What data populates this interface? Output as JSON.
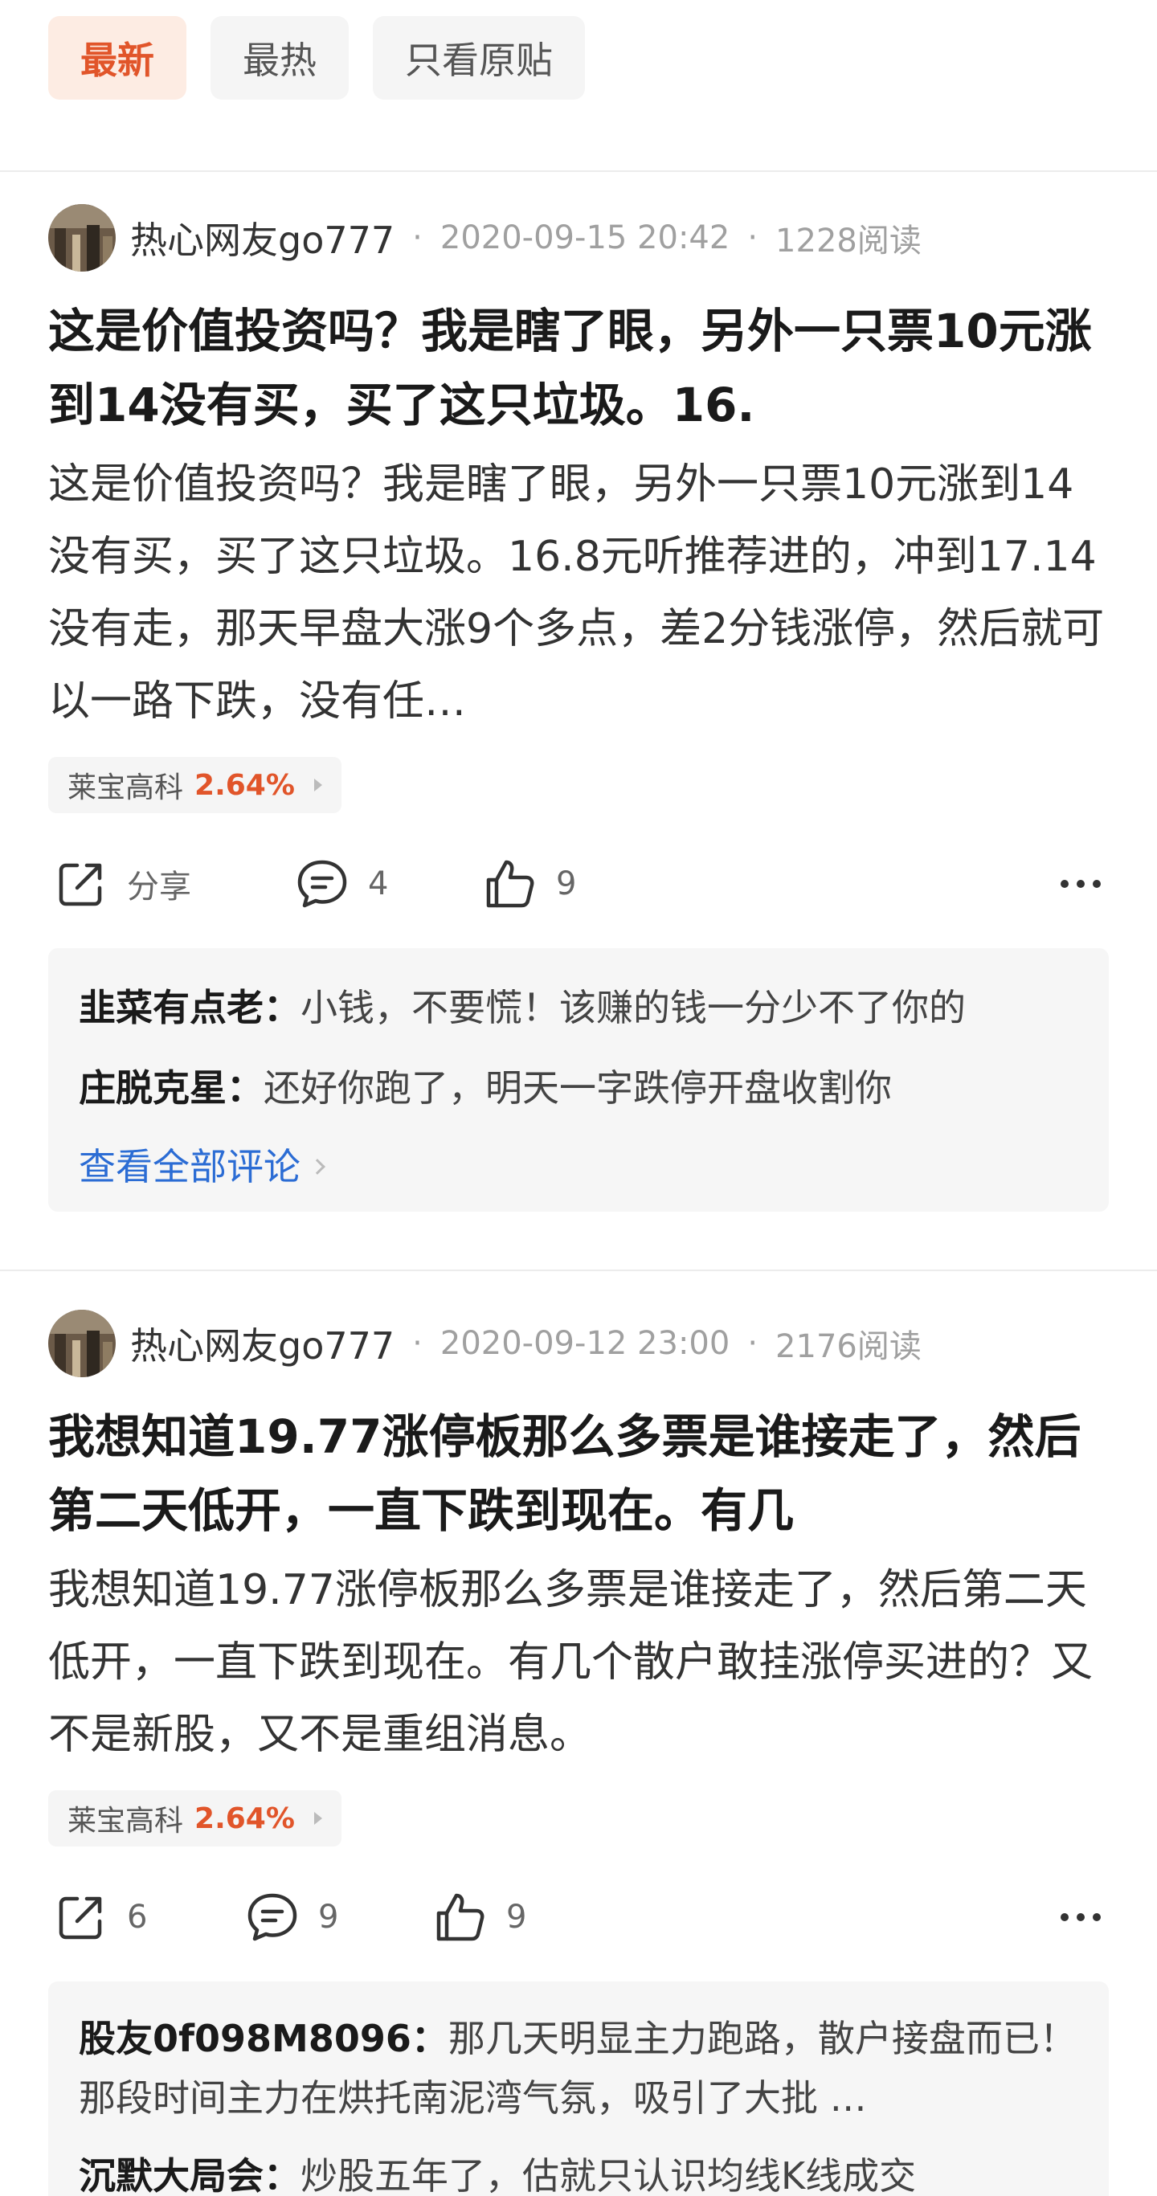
{
  "tabs": [
    {
      "label": "最新"
    },
    {
      "label": "最热"
    },
    {
      "label": "只看原贴"
    }
  ],
  "colors": {
    "accent": "#e1552a",
    "link": "#2b6cd4"
  },
  "posts": [
    {
      "author": "热心网友go777",
      "time": "2020-09-15 20:42",
      "reads": "1228阅读",
      "title": "这是价值投资吗？我是瞎了眼，另外一只票10元涨到14没有买，买了这只垃圾。16.",
      "body": "这是价值投资吗？我是瞎了眼，另外一只票10元涨到14没有买，买了这只垃圾。16.8元听推荐进的，冲到17.14没有走，那天早盘大涨9个多点，差2分钱涨停，然后就可以一路下跌，没有任…",
      "stock": {
        "name": "莱宝高科",
        "pct": "2.64%"
      },
      "share": "分享",
      "comments_count": "4",
      "likes": "9",
      "comments": [
        {
          "user": "韭菜有点老",
          "text": "小钱，不要慌！该赚的钱一分少不了你的"
        },
        {
          "user": "庄脱克星",
          "text": "还好你跑了，明天一字跌停开盘收割你"
        }
      ],
      "view_all": "查看全部评论"
    },
    {
      "author": "热心网友go777",
      "time": "2020-09-12 23:00",
      "reads": "2176阅读",
      "title": "我想知道19.77涨停板那么多票是谁接走了，然后第二天低开，一直下跌到现在。有几",
      "body": "我想知道19.77涨停板那么多票是谁接走了，然后第二天低开，一直下跌到现在。有几个散户敢挂涨停买进的？又不是新股，又不是重组消息。",
      "stock": {
        "name": "莱宝高科",
        "pct": "2.64%"
      },
      "share": "6",
      "comments_count": "9",
      "likes": "9",
      "comments": [
        {
          "user": "股友0f098M8096",
          "text": "那几天明显主力跑路，散户接盘而已！那段时间主力在烘托南泥湾气氛，吸引了大批 …"
        },
        {
          "user": "沉默大局会",
          "text": "炒股五年了，估就只认识均线K线成交"
        }
      ]
    }
  ]
}
